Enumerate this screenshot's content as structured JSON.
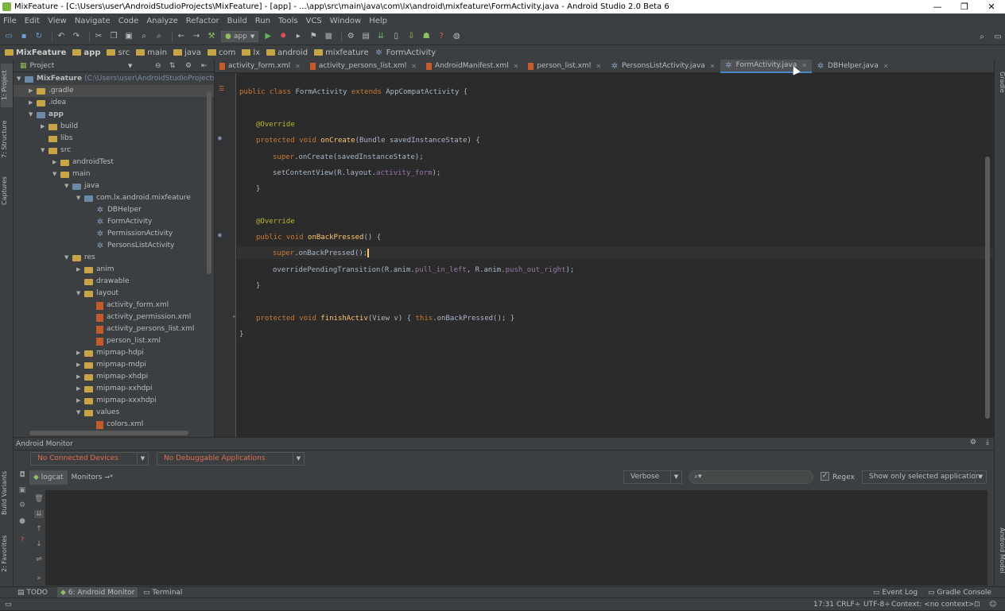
{
  "window": {
    "title": "MixFeature - [C:\\Users\\user\\AndroidStudioProjects\\MixFeature] - [app] - ...\\app\\src\\main\\java\\com\\lx\\android\\mixfeature\\FormActivity.java - Android Studio 2.0 Beta 6",
    "minimize": "—",
    "restore": "❐",
    "close": "✕"
  },
  "menu": [
    "File",
    "Edit",
    "View",
    "Navigate",
    "Code",
    "Analyze",
    "Refactor",
    "Build",
    "Run",
    "Tools",
    "VCS",
    "Window",
    "Help"
  ],
  "toolbar": {
    "run_config": "app"
  },
  "breadcrumbs": [
    "MixFeature",
    "app",
    "src",
    "main",
    "java",
    "com",
    "lx",
    "android",
    "mixfeature",
    "FormActivity"
  ],
  "project_panel": {
    "title": "Project",
    "tree": [
      {
        "label": "MixFeature",
        "suffix": "(C:\\Users\\user\\AndroidStudioProjects\\M",
        "depth": 0,
        "open": true,
        "kind": "module"
      },
      {
        "label": ".gradle",
        "depth": 1,
        "open": false,
        "kind": "folder",
        "selected": true
      },
      {
        "label": ".idea",
        "depth": 1,
        "open": false,
        "kind": "folder"
      },
      {
        "label": "app",
        "depth": 1,
        "open": true,
        "kind": "module"
      },
      {
        "label": "build",
        "depth": 2,
        "open": false,
        "kind": "folder"
      },
      {
        "label": "libs",
        "depth": 2,
        "open": null,
        "kind": "folder"
      },
      {
        "label": "src",
        "depth": 2,
        "open": true,
        "kind": "folder"
      },
      {
        "label": "androidTest",
        "depth": 3,
        "open": false,
        "kind": "folder"
      },
      {
        "label": "main",
        "depth": 3,
        "open": true,
        "kind": "folder"
      },
      {
        "label": "java",
        "depth": 4,
        "open": true,
        "kind": "src"
      },
      {
        "label": "com.lx.android.mixfeature",
        "depth": 5,
        "open": true,
        "kind": "package"
      },
      {
        "label": "DBHelper",
        "depth": 6,
        "open": null,
        "kind": "java"
      },
      {
        "label": "FormActivity",
        "depth": 6,
        "open": null,
        "kind": "java"
      },
      {
        "label": "PermissionActivity",
        "depth": 6,
        "open": null,
        "kind": "java"
      },
      {
        "label": "PersonsListActivity",
        "depth": 6,
        "open": null,
        "kind": "java"
      },
      {
        "label": "res",
        "depth": 4,
        "open": true,
        "kind": "res"
      },
      {
        "label": "anim",
        "depth": 5,
        "open": false,
        "kind": "folder"
      },
      {
        "label": "drawable",
        "depth": 5,
        "open": null,
        "kind": "folder"
      },
      {
        "label": "layout",
        "depth": 5,
        "open": true,
        "kind": "folder"
      },
      {
        "label": "activity_form.xml",
        "depth": 6,
        "open": null,
        "kind": "xml"
      },
      {
        "label": "activity_permission.xml",
        "depth": 6,
        "open": null,
        "kind": "xml"
      },
      {
        "label": "activity_persons_list.xml",
        "depth": 6,
        "open": null,
        "kind": "xml"
      },
      {
        "label": "person_list.xml",
        "depth": 6,
        "open": null,
        "kind": "xml"
      },
      {
        "label": "mipmap-hdpi",
        "depth": 5,
        "open": false,
        "kind": "folder"
      },
      {
        "label": "mipmap-mdpi",
        "depth": 5,
        "open": false,
        "kind": "folder"
      },
      {
        "label": "mipmap-xhdpi",
        "depth": 5,
        "open": false,
        "kind": "folder"
      },
      {
        "label": "mipmap-xxhdpi",
        "depth": 5,
        "open": false,
        "kind": "folder"
      },
      {
        "label": "mipmap-xxxhdpi",
        "depth": 5,
        "open": false,
        "kind": "folder"
      },
      {
        "label": "values",
        "depth": 5,
        "open": true,
        "kind": "folder"
      },
      {
        "label": "colors.xml",
        "depth": 6,
        "open": null,
        "kind": "xml"
      }
    ]
  },
  "tabs": [
    {
      "label": "activity_form.xml",
      "kind": "xml",
      "active": false
    },
    {
      "label": "activity_persons_list.xml",
      "kind": "xml",
      "active": false
    },
    {
      "label": "AndroidManifest.xml",
      "kind": "xml",
      "active": false
    },
    {
      "label": "person_list.xml",
      "kind": "xml",
      "active": false
    },
    {
      "label": "PersonsListActivity.java",
      "kind": "java",
      "active": false
    },
    {
      "label": "FormActivity.java",
      "kind": "java",
      "active": true
    },
    {
      "label": "DBHelper.java",
      "kind": "java",
      "active": false
    }
  ],
  "code": {
    "l1_kw": "public class ",
    "l1_name": "FormActivity ",
    "l1_kw2": "extends ",
    "l1_super": "AppCompatActivity {",
    "override1": "@Override",
    "oncreate_kw": "protected void ",
    "oncreate_fn": "onCreate",
    "oncreate_args": "(Bundle savedInstanceState) {",
    "super_kw": "super",
    "super_oncreate": ".onCreate(savedInstanceState);",
    "setcontent": "setContentView(R.layout.",
    "setcontent_field": "activity_form",
    "setcontent_end": ");",
    "close1": "}",
    "override2": "@Override",
    "onback_kw": "public void ",
    "onback_fn": "onBackPressed",
    "onback_args": "() {",
    "super_onback": ".onBackPressed();",
    "override_pt": "overridePendingTransition(R.anim.",
    "anim1": "pull_in_left",
    "comma": ", R.anim.",
    "anim2": "push_out_right",
    "override_pt_end": ");",
    "close2": "}",
    "finish_kw": "protected void ",
    "finish_fn": "finishActiv",
    "finish_args": "(View v) { ",
    "this_kw": "this",
    "finish_body": ".onBackPressed(); }",
    "close3": "}"
  },
  "monitor": {
    "title": "Android Monitor",
    "devices": "No Connected Devices",
    "apps": "No Debuggable Applications",
    "tab_logcat": "logcat",
    "tab_monitors": "Monitors",
    "tab_monitors_suffix": "→*",
    "log_level": "Verbose",
    "search_placeholder": "",
    "regex_label": "Regex",
    "filter": "Show only selected application"
  },
  "left_tools": [
    "1: Project",
    "7: Structure",
    "Captures",
    "Build Variants",
    "2: Favorites"
  ],
  "right_tools": [
    "Gradle",
    "Android Model"
  ],
  "bottom_tools": {
    "todo": "TODO",
    "monitor": "6: Android Monitor",
    "terminal": "Terminal",
    "event_log": "Event Log",
    "gradle_console": "Gradle Console"
  },
  "status": {
    "position": "17:31",
    "line_sep": "CRLF÷",
    "encoding": "UTF-8÷",
    "context": "Context: <no context>"
  },
  "colors": {
    "accent": "#4a88c7",
    "error": "#e06c50",
    "keyword": "#cc7832",
    "annotation": "#bbb529",
    "function": "#ffc66d"
  }
}
